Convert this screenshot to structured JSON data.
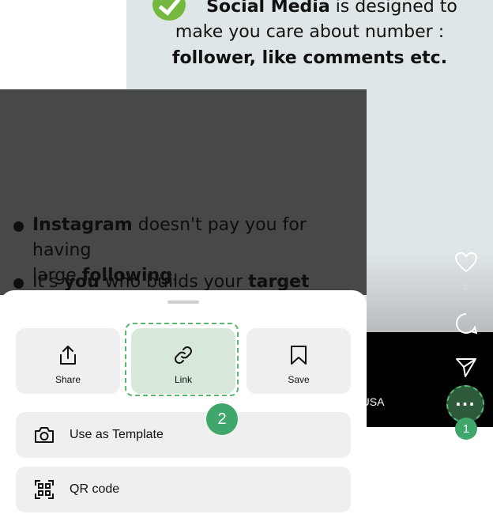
{
  "slide_top": {
    "line1_bold": "Social Media",
    "line1_rest": " is designed to",
    "line2": "make you care about number :",
    "line3": "follower, like comments etc."
  },
  "slide_dark": {
    "bullet1_bold": "Instagram",
    "bullet1_rest1": " doesn't pay you for having",
    "bullet1_rest2": "large ",
    "bullet1_bold2": "following",
    "bullet1_end": ".",
    "bullet2_pre": "It's ",
    "bullet2_bold1": "you",
    "bullet2_mid": " who builds your ",
    "bullet2_bold2": "target"
  },
  "reel": {
    "like_count": "3",
    "location": "n,USA",
    "more_label": "···"
  },
  "badges": {
    "step1": "1",
    "step2": "2"
  },
  "sheet": {
    "share_label": "Share",
    "link_label": "Link",
    "save_label": "Save",
    "template_label": "Use as Template",
    "qr_label": "QR code"
  },
  "icons": {
    "share": "share-icon",
    "link": "link-icon",
    "save": "bookmark-icon",
    "template": "camera-icon",
    "qr": "qr-code-icon",
    "like": "heart-icon",
    "comment": "comment-icon",
    "send": "send-icon",
    "more": "more-icon"
  },
  "colors": {
    "highlight": "#57b96f",
    "badge": "#3fa76b",
    "check": "#74b83f"
  }
}
